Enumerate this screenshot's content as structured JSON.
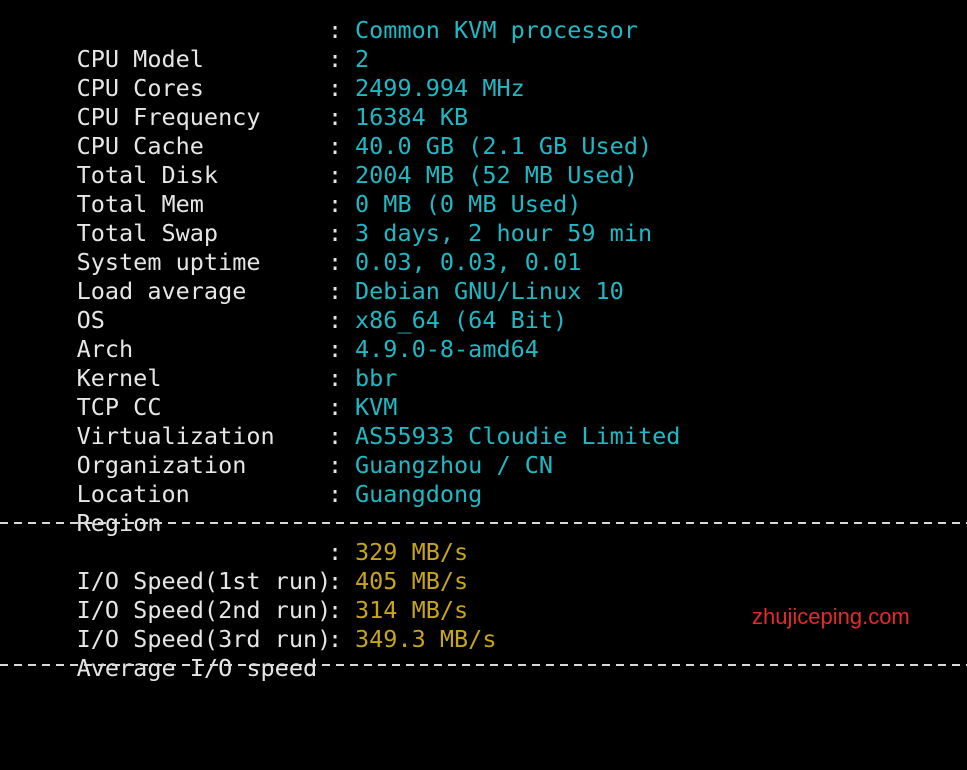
{
  "system_info": [
    {
      "label": "CPU Model",
      "value": "Common KVM processor"
    },
    {
      "label": "CPU Cores",
      "value": "2"
    },
    {
      "label": "CPU Frequency",
      "value": "2499.994 MHz"
    },
    {
      "label": "CPU Cache",
      "value": "16384 KB"
    },
    {
      "label": "Total Disk",
      "value": "40.0 GB (2.1 GB Used)"
    },
    {
      "label": "Total Mem",
      "value": "2004 MB (52 MB Used)"
    },
    {
      "label": "Total Swap",
      "value": "0 MB (0 MB Used)"
    },
    {
      "label": "System uptime",
      "value": "3 days, 2 hour 59 min"
    },
    {
      "label": "Load average",
      "value": "0.03, 0.03, 0.01"
    },
    {
      "label": "OS",
      "value": "Debian GNU/Linux 10"
    },
    {
      "label": "Arch",
      "value": "x86_64 (64 Bit)"
    },
    {
      "label": "Kernel",
      "value": "4.9.0-8-amd64"
    },
    {
      "label": "TCP CC",
      "value": "bbr"
    },
    {
      "label": "Virtualization",
      "value": "KVM"
    },
    {
      "label": "Organization",
      "value": "AS55933 Cloudie Limited"
    },
    {
      "label": "Location",
      "value": "Guangzhou / CN"
    },
    {
      "label": "Region",
      "value": "Guangdong"
    }
  ],
  "io_speed": [
    {
      "label": "I/O Speed(1st run)",
      "value": "329 MB/s"
    },
    {
      "label": "I/O Speed(2nd run)",
      "value": "405 MB/s"
    },
    {
      "label": "I/O Speed(3rd run)",
      "value": "314 MB/s"
    },
    {
      "label": "Average I/O speed",
      "value": "349.3 MB/s"
    }
  ],
  "separator": ":",
  "watermark": "zhujiceping.com",
  "colors": {
    "background": "#000000",
    "label": "#e6e6e6",
    "info_value": "#1fb8c4",
    "io_value": "#c7a41a",
    "watermark": "#e52a2a"
  }
}
